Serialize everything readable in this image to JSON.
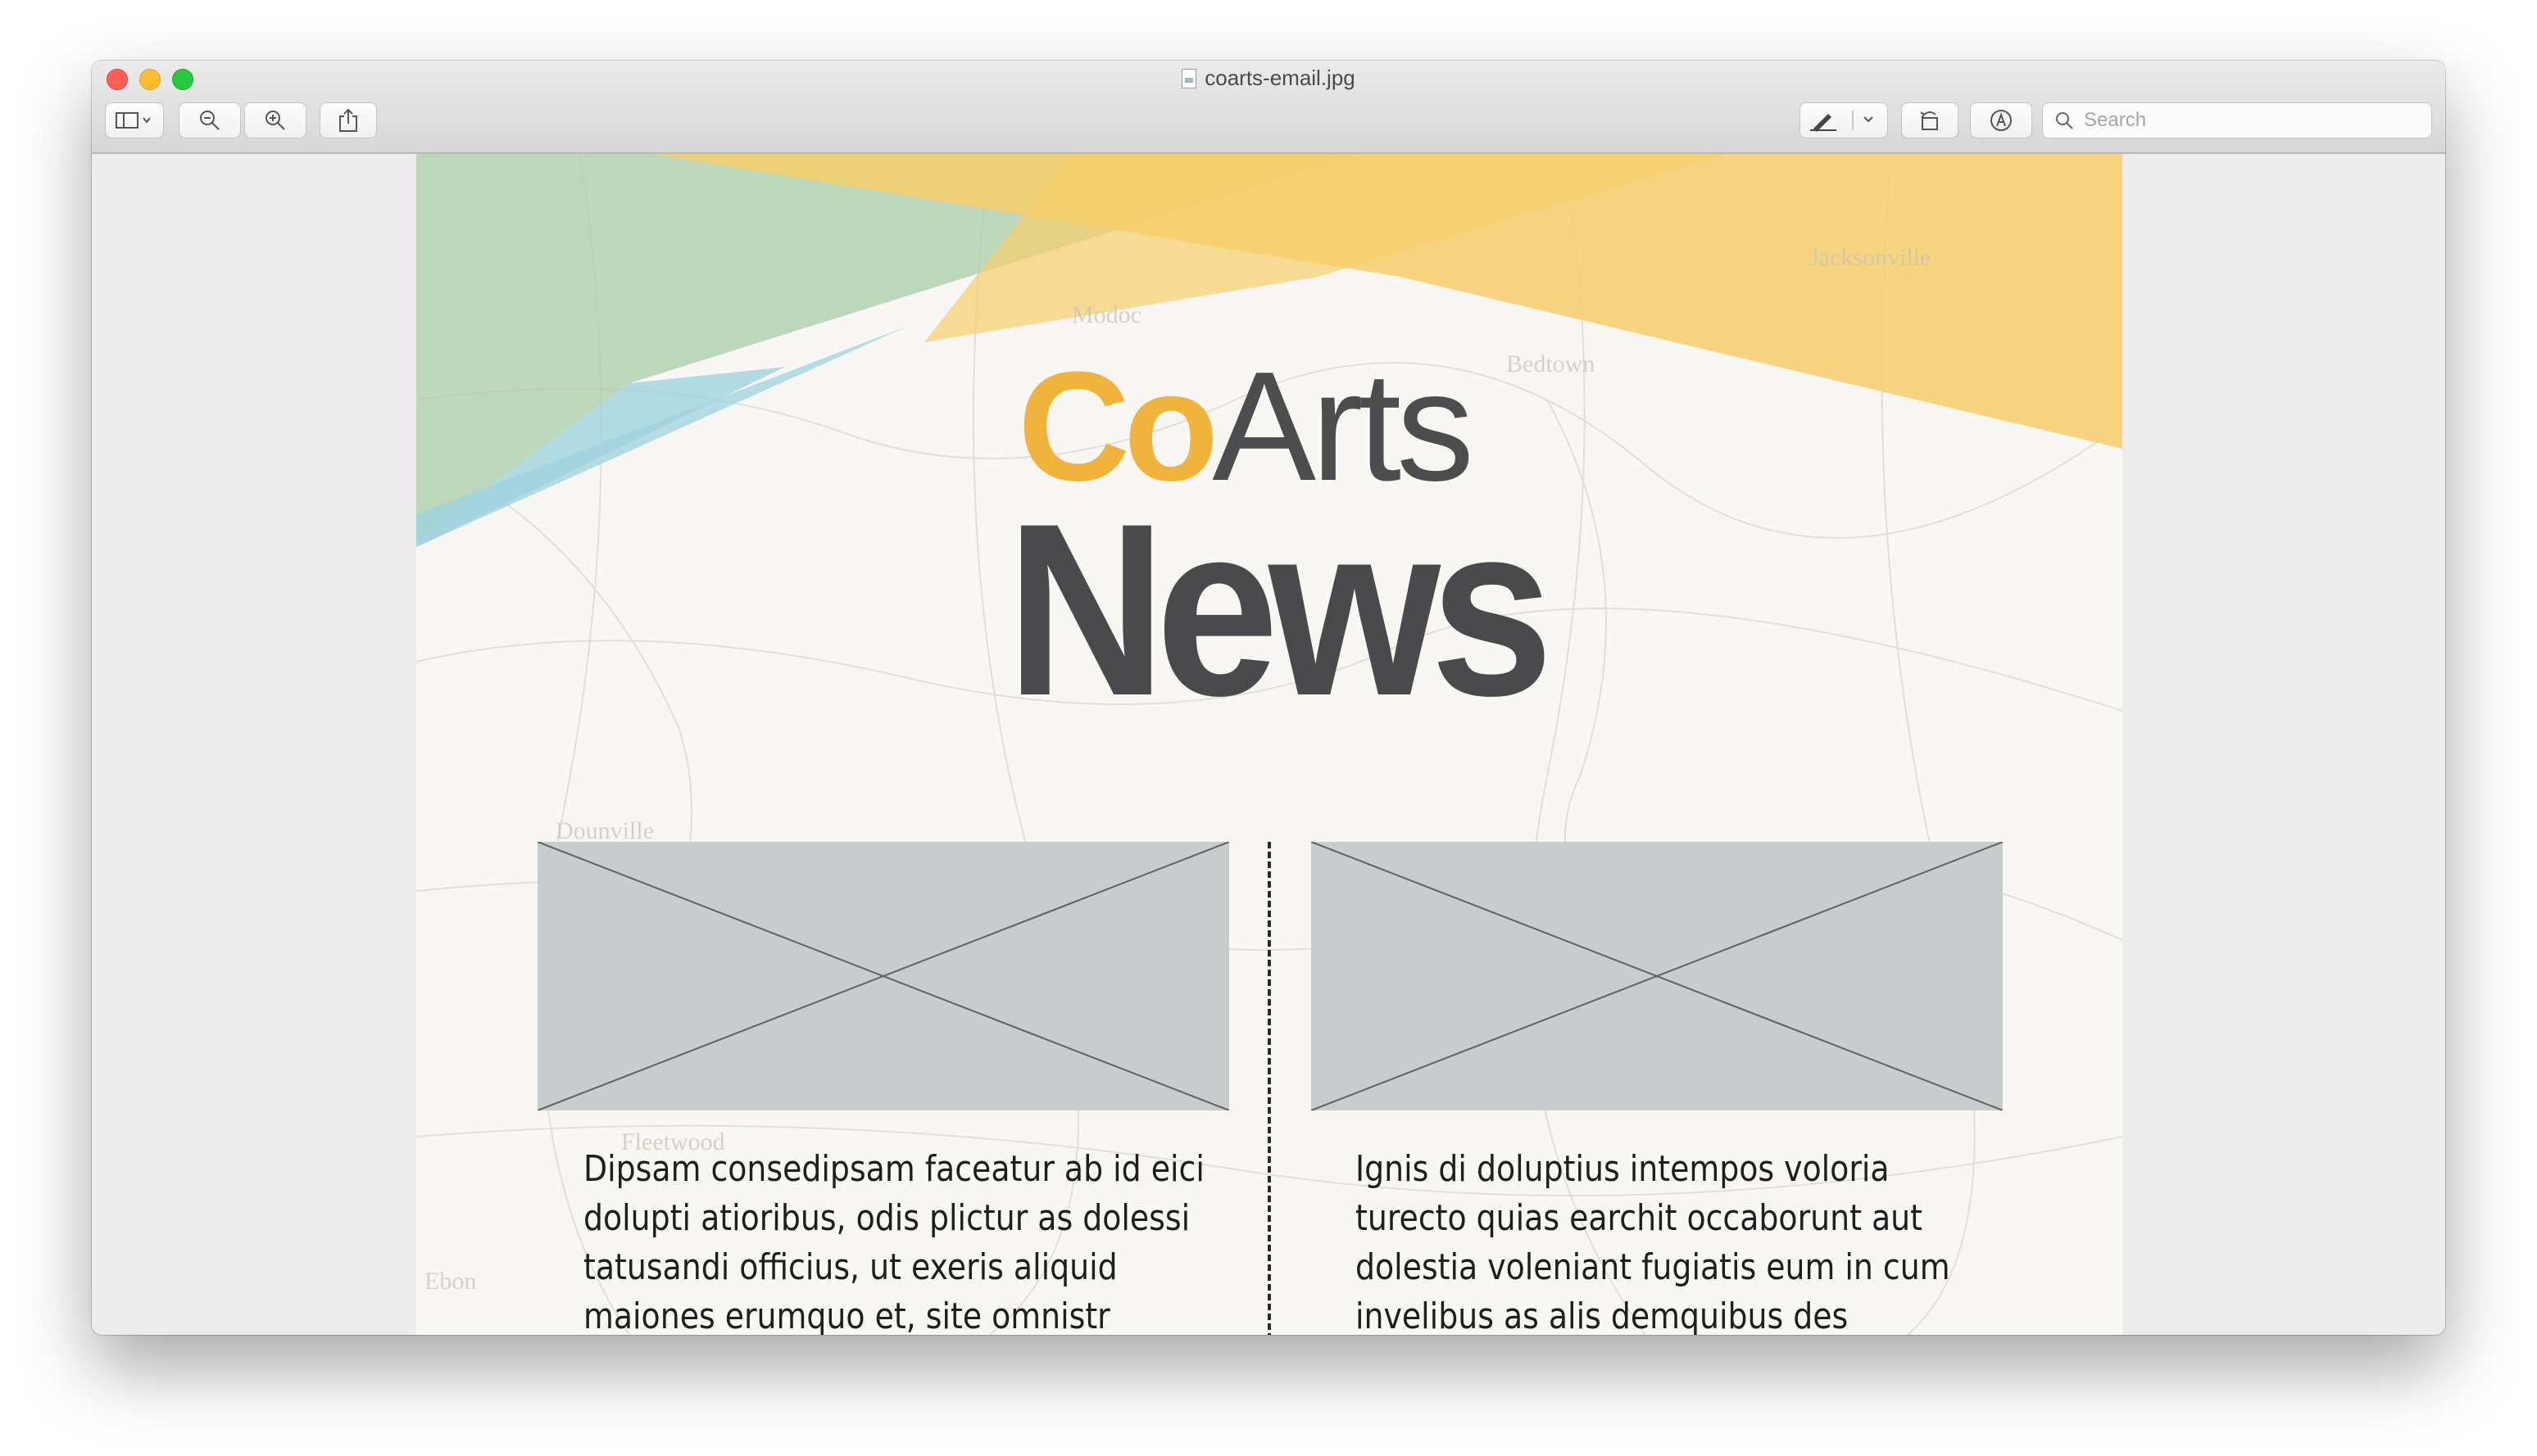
{
  "window": {
    "title": "coarts-email.jpg"
  },
  "toolbar": {
    "buttons": [
      {
        "name": "sidebar-toggle",
        "icon": "sidebar-icon"
      },
      {
        "name": "zoom-out",
        "icon": "zoom-out-icon"
      },
      {
        "name": "zoom-in",
        "icon": "zoom-in-icon"
      },
      {
        "name": "share",
        "icon": "share-icon"
      },
      {
        "name": "markup-pen",
        "icon": "pen-icon"
      },
      {
        "name": "rotate",
        "icon": "rotate-icon"
      },
      {
        "name": "annotate",
        "icon": "markup-circle-icon"
      }
    ],
    "search": {
      "placeholder": "Search"
    }
  },
  "document": {
    "logo": {
      "co": "Co",
      "arts": "Arts"
    },
    "headline": "News",
    "map_labels": [
      "Jacksonville",
      "Bedtown",
      "Modoc",
      "Dounville",
      "Ebon",
      "Fleetwood"
    ],
    "articles": [
      {
        "text": "Dipsam consedipsam faceatur ab id eici dolupti atioribus, odis plictur as dolessi tatusandi officius, ut exeris aliquid maiones erumquo et, site omnistr"
      },
      {
        "text": "Ignis di doluptius intempos voloria turecto quias earchit occaborunt aut dolestia voleniant fugiatis eum in cum invelibus as alis demquibus des"
      }
    ]
  },
  "colors": {
    "logo_yellow": "#f0b43c",
    "text_dark": "#4a4a4c",
    "band_yellow": "#f7cf6b",
    "band_green": "#a9cca8",
    "band_blue": "#9fd2df",
    "placeholder_gray": "#c9cccd"
  }
}
